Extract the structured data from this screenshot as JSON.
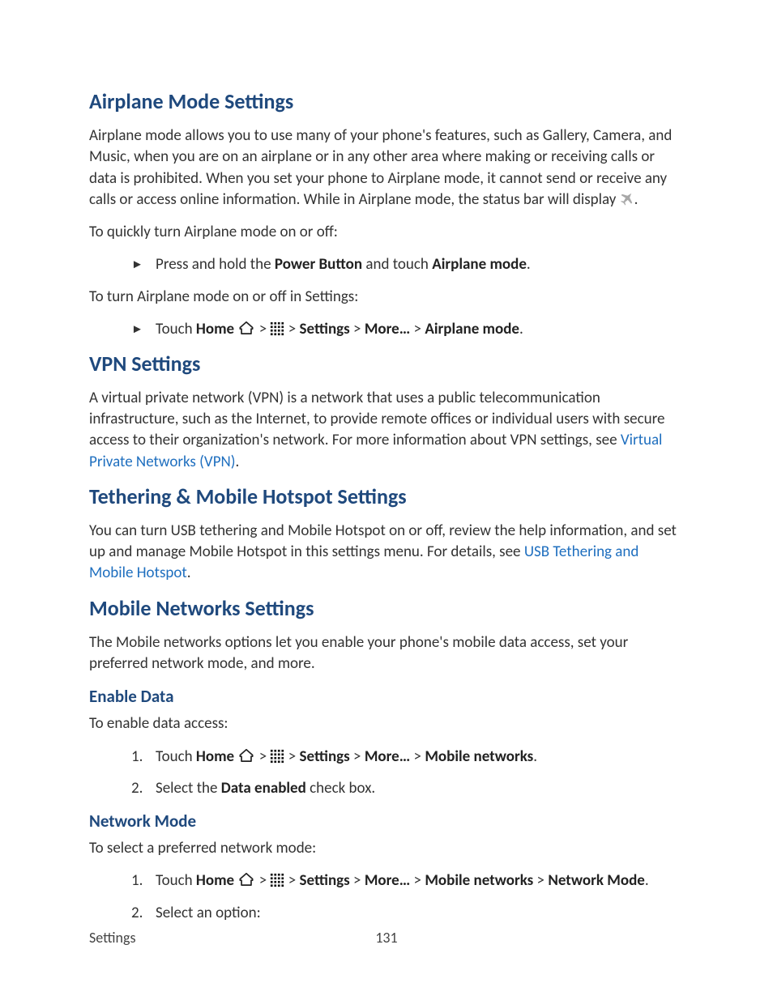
{
  "footer": {
    "section": "Settings",
    "page": "131"
  },
  "sections": {
    "airplane": {
      "heading": "Airplane Mode Settings",
      "para1_a": "Airplane mode allows you to use many of your phone's features, such as Gallery, Camera, and Music, when you are on an airplane or in any other area where making or receiving calls or data is prohibited. When you set your phone to Airplane mode, it cannot send or receive any calls or access online information. While in Airplane mode, the status bar will display ",
      "para1_b": ".",
      "para2": "To quickly turn Airplane mode on or off:",
      "bul1_a": "Press and hold the ",
      "bul1_power": "Power Button",
      "bul1_b": " and touch ",
      "bul1_mode": "Airplane mode",
      "bul1_c": ".",
      "para3": "To turn Airplane mode on or off in Settings:",
      "bul2_touch": "Touch ",
      "bul2_home": "Home",
      "bul2_gt1": " > ",
      "bul2_gt2": " > ",
      "bul2_settings": "Settings",
      "bul2_gt3": " > ",
      "bul2_more": "More…",
      "bul2_gt4": " > ",
      "bul2_mode": "Airplane mode",
      "bul2_end": "."
    },
    "vpn": {
      "heading": "VPN Settings",
      "para_a": "A virtual private network (VPN) is a network that uses a public telecommunication infrastructure, such as the Internet, to provide remote offices or individual users with secure access to their organization's network. For more information about VPN settings, see ",
      "link": "Virtual Private Networks (VPN)",
      "para_b": "."
    },
    "tether": {
      "heading": "Tethering & Mobile Hotspot Settings",
      "para_a": "You can turn USB tethering and Mobile Hotspot on or off, review the help information, and set up and manage Mobile Hotspot in this settings menu. For details, see ",
      "link": "USB Tethering and Mobile Hotspot",
      "para_b": "."
    },
    "mobile": {
      "heading": "Mobile Networks Settings",
      "para": "The Mobile networks options let you enable your phone's mobile data access, set your preferred network mode, and more.",
      "enable": {
        "heading": "Enable Data",
        "para": "To enable data access:",
        "s1_touch": "Touch ",
        "s1_home": "Home",
        "s1_gt1": " > ",
        "s1_gt2": " > ",
        "s1_settings": "Settings",
        "s1_gt3": " > ",
        "s1_more": "More…",
        "s1_gt4": " > ",
        "s1_net": "Mobile networks",
        "s1_end": ".",
        "s2_a": "Select the ",
        "s2_b": "Data enabled",
        "s2_c": " check box."
      },
      "mode": {
        "heading": "Network Mode",
        "para": "To select a preferred network mode:",
        "s1_touch": "Touch ",
        "s1_home": "Home",
        "s1_gt1": " > ",
        "s1_gt2": " > ",
        "s1_settings": "Settings",
        "s1_gt3": " > ",
        "s1_more": "More…",
        "s1_gt4": " > ",
        "s1_net": "Mobile networks",
        "s1_gt5": " > ",
        "s1_mode": "Network Mode",
        "s1_end": ".",
        "s2": "Select an option:"
      }
    }
  },
  "markers": {
    "arrow": "►",
    "n1": "1.",
    "n2": "2."
  }
}
